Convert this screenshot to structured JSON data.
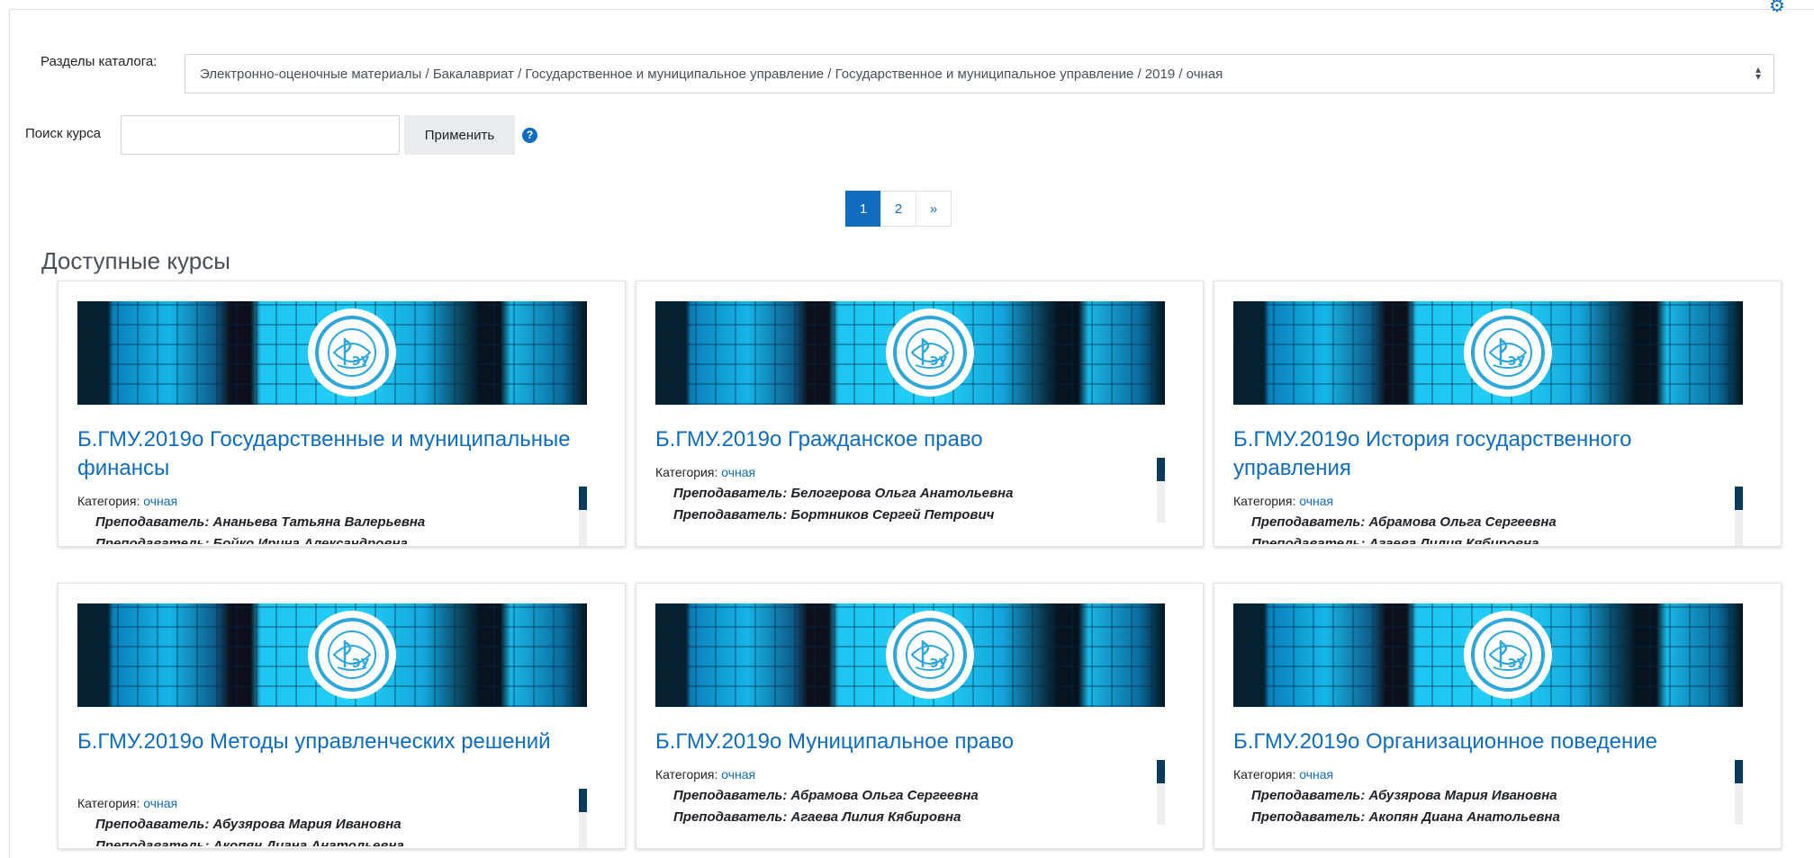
{
  "catalog": {
    "label": "Разделы каталога:",
    "selected": "Электронно-оценочные материалы / Бакалавриат / Государственное и муниципальное управление / Государственное и муниципальное управление / 2019 / очная"
  },
  "search": {
    "label": "Поиск курса",
    "value": "",
    "apply_label": "Применить"
  },
  "pagination": {
    "pages": [
      "1",
      "2",
      "»"
    ]
  },
  "section_title": "Доступные курсы",
  "category_label": "Категория:",
  "courses": [
    {
      "title": "Б.ГМУ.2019о Государственные и муниципальные финансы",
      "category": "очная",
      "teachers": [
        "Преподаватель: Ананьева Татьяна Валерьевна",
        "Преподаватель: Бойко Ирина Александровна"
      ]
    },
    {
      "title": "Б.ГМУ.2019о Гражданское право",
      "category": "очная",
      "teachers": [
        "Преподаватель: Белогерова Ольга Анатольевна",
        "Преподаватель: Бортников Сергей Петрович"
      ]
    },
    {
      "title": "Б.ГМУ.2019о История государственного управления",
      "category": "очная",
      "teachers": [
        "Преподаватель: Абрамова Ольга Сергеевна",
        "Преподаватель: Агаева Лилия Кябировна"
      ]
    },
    {
      "title": "Б.ГМУ.2019о Методы управленческих решений",
      "category": "очная",
      "teachers": [
        "Преподаватель: Абузярова Мария Ивановна",
        "Преподаватель: Акопян Диана Анатольевна"
      ]
    },
    {
      "title": "Б.ГМУ.2019о Муниципальное право",
      "category": "очная",
      "teachers": [
        "Преподаватель: Абрамова Ольга Сергеевна",
        "Преподаватель: Агаева Лилия Кябировна"
      ]
    },
    {
      "title": "Б.ГМУ.2019о Организационное поведение",
      "category": "очная",
      "teachers": [
        "Преподаватель: Абузярова Мария Ивановна",
        "Преподаватель: Акопян Диана Анатольевна"
      ]
    }
  ],
  "icons": {
    "gear": "gear-icon",
    "help": "question-circle-icon",
    "select_arrows": "sort-arrows-icon"
  },
  "colors": {
    "accent": "#0f6cbf",
    "scroll_thumb": "#0a3a5c"
  }
}
